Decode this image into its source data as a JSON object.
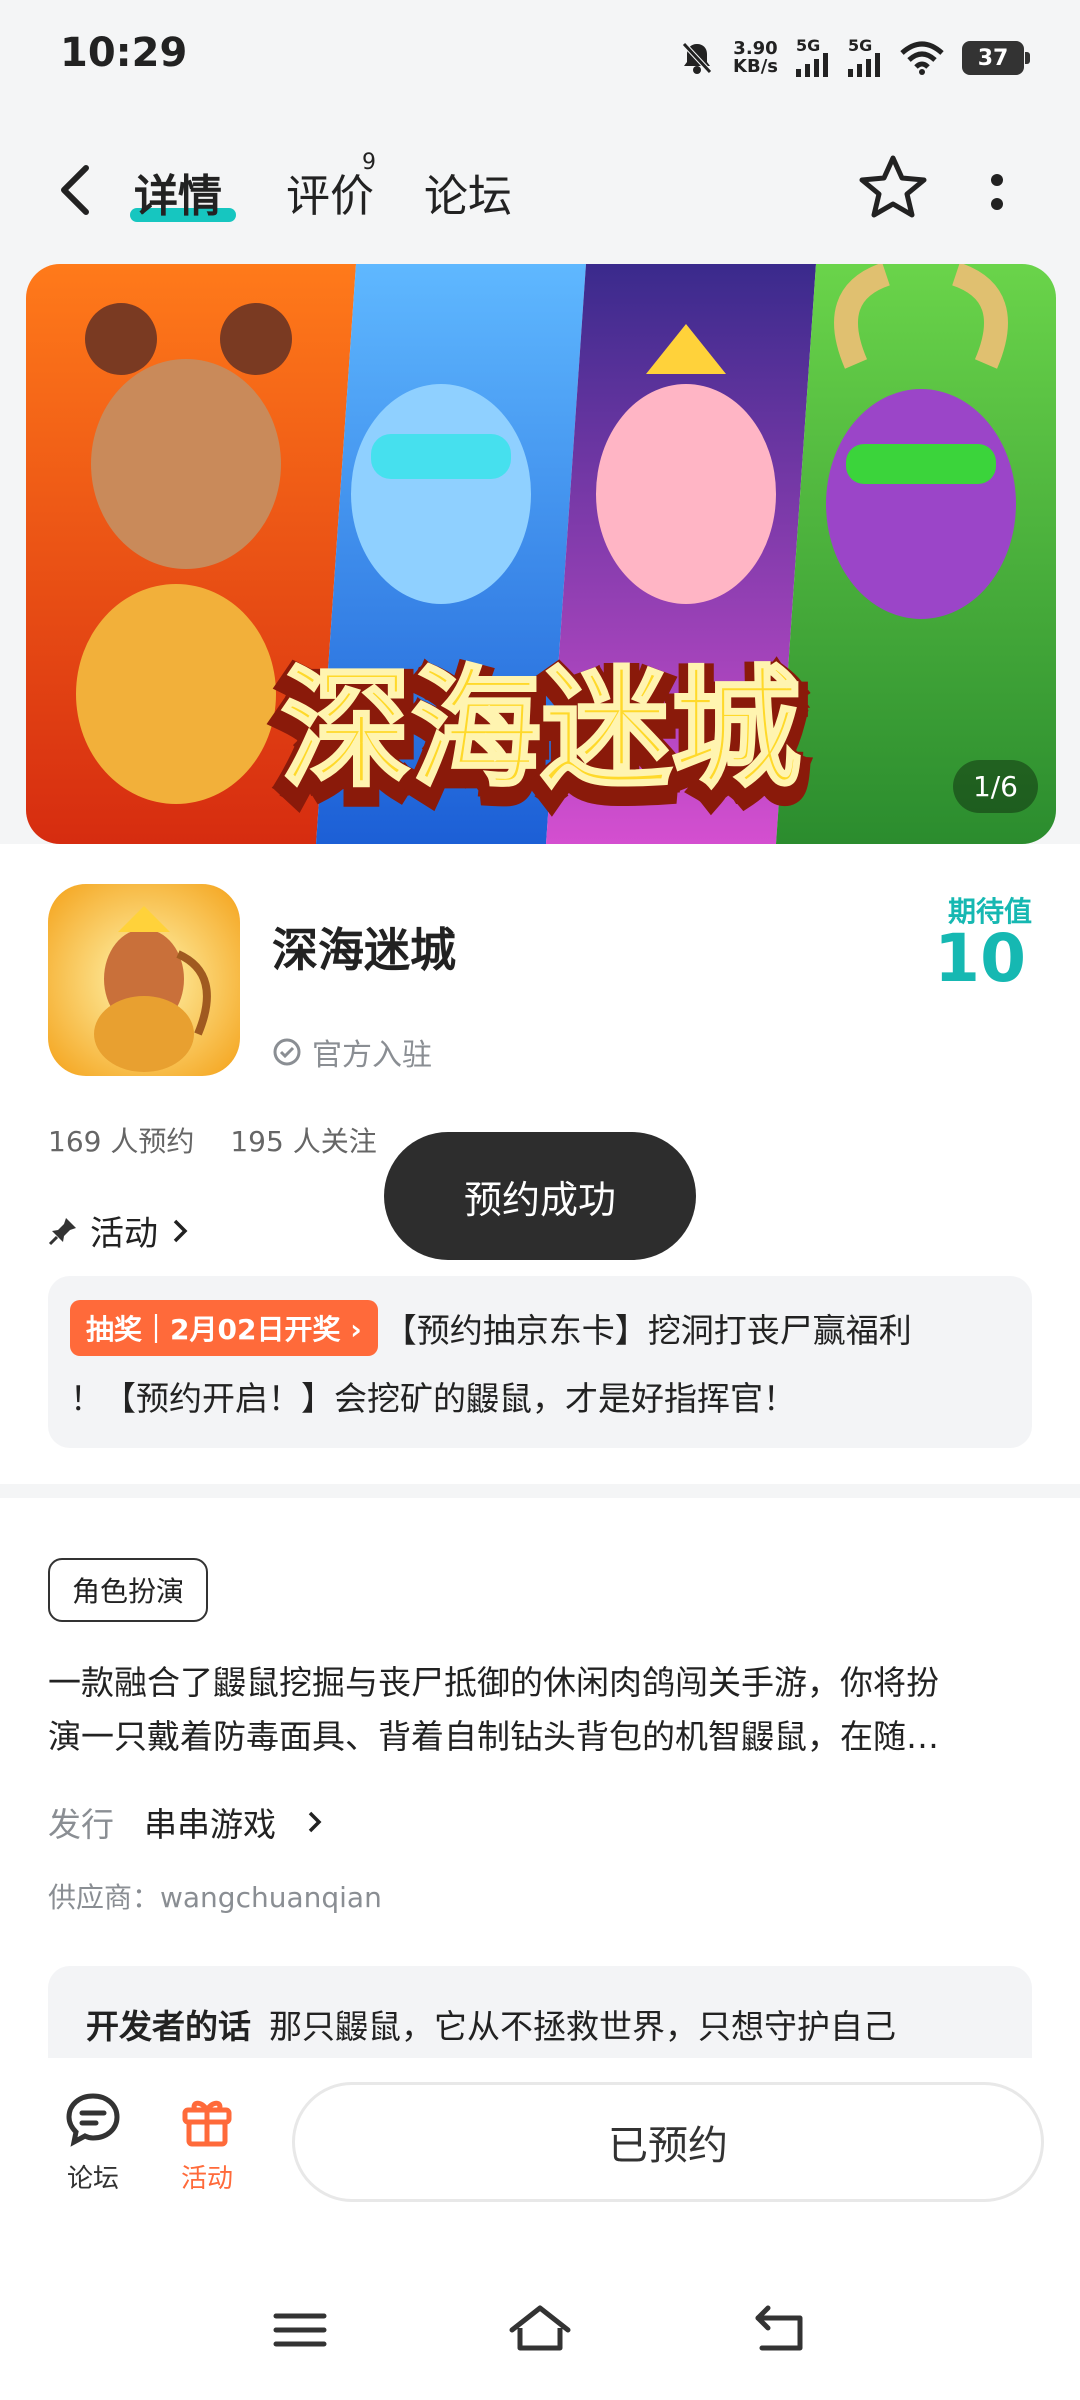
{
  "status_bar": {
    "time": "10:29",
    "net_speed_value": "3.90",
    "net_speed_unit": "KB/s",
    "sim1": "5G",
    "sim2": "5G",
    "battery": "37"
  },
  "nav": {
    "tabs": [
      {
        "label": "详情",
        "active": true
      },
      {
        "label": "评价",
        "badge": "9"
      },
      {
        "label": "论坛"
      }
    ]
  },
  "banner": {
    "page_indicator": "1/6",
    "title_art": "深海迷城"
  },
  "app": {
    "name": "深海迷城",
    "official_label": "官方入驻",
    "expectation_label": "期待值",
    "expectation_value": "10",
    "reservations": "169 人预约",
    "followers": "195 人关注"
  },
  "activity": {
    "label": "活动",
    "promo_badge": "抽奖｜2月02日开奖 ›",
    "promo_text_1": "【预约抽京东卡】挖洞打丧尸赢福利",
    "promo_text_2": "！【预约开启！】会挖矿的鼹鼠，才是好指挥官！"
  },
  "toast": "预约成功",
  "details": {
    "tag": "角色扮演",
    "description_1": "一款融合了鼹鼠挖掘与丧尸抵御的休闲肉鸽闯关手游，你将扮",
    "description_2": "演一只戴着防毒面具、背着自制钻头背包的机智鼹鼠，在随…",
    "publisher_label": "发行",
    "publisher_value": "串串游戏",
    "supplier": "供应商：wangchuanqian",
    "dev_label": "开发者的话",
    "dev_text": "那只鼹鼠，它从不拯救世界，只想守护自己"
  },
  "bottom_bar": {
    "forum_label": "论坛",
    "activity_label": "活动",
    "reserved_button": "已预约"
  },
  "colors": {
    "accent": "#16c6c0",
    "orange": "#ff6a3a",
    "toast_bg": "#2d2d2d"
  }
}
